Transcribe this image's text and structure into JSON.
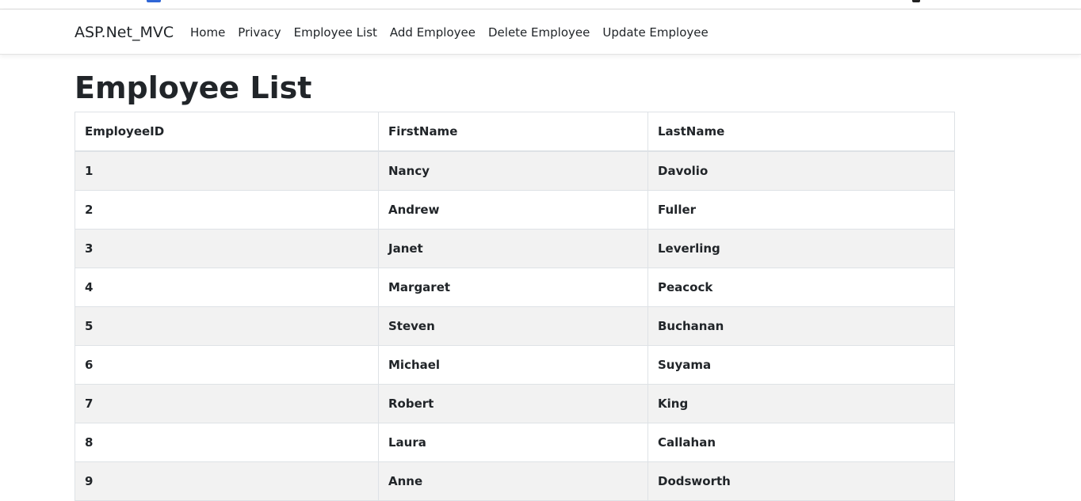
{
  "navbar": {
    "brand": "ASP.Net_MVC",
    "links": [
      "Home",
      "Privacy",
      "Employee List",
      "Add Employee",
      "Delete Employee",
      "Update Employee"
    ]
  },
  "page": {
    "title": "Employee List"
  },
  "table": {
    "headers": [
      "EmployeeID",
      "FirstName",
      "LastName"
    ],
    "rows": [
      [
        "1",
        "Nancy",
        "Davolio"
      ],
      [
        "2",
        "Andrew",
        "Fuller"
      ],
      [
        "3",
        "Janet",
        "Leverling"
      ],
      [
        "4",
        "Margaret",
        "Peacock"
      ],
      [
        "5",
        "Steven",
        "Buchanan"
      ],
      [
        "6",
        "Michael",
        "Suyama"
      ],
      [
        "7",
        "Robert",
        "King"
      ],
      [
        "8",
        "Laura",
        "Callahan"
      ],
      [
        "9",
        "Anne",
        "Dodsworth"
      ]
    ]
  }
}
